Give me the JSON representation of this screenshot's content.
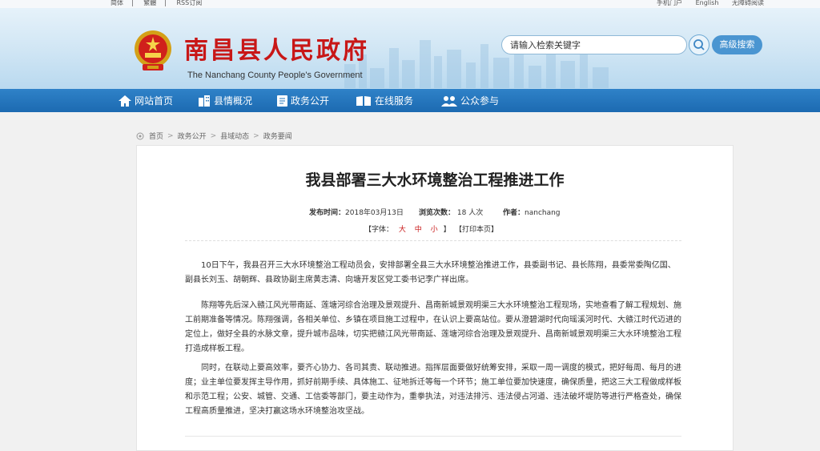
{
  "topbar": {
    "left_items": [
      "简体",
      "繁體",
      "RSS订阅"
    ],
    "right_items": [
      "手机门户",
      "English",
      "无障碍阅读"
    ]
  },
  "header": {
    "site_title": "南昌县人民政府",
    "site_subtitle": "The Nanchang County People's Government",
    "search_placeholder": "请输入检索关键字",
    "advanced_search_label": "高级搜索",
    "emblem_icon": "national-emblem-icon",
    "search_icon": "search-icon",
    "brand_color": "#c81717",
    "nav_color": "#1f6fb6"
  },
  "nav": {
    "items": [
      {
        "label": "网站首页",
        "icon": "home-icon"
      },
      {
        "label": "县情概况",
        "icon": "building-icon"
      },
      {
        "label": "政务公开",
        "icon": "document-icon"
      },
      {
        "label": "在线服务",
        "icon": "book-icon"
      },
      {
        "label": "公众参与",
        "icon": "users-icon"
      }
    ]
  },
  "breadcrumb": [
    "首页",
    "政务公开",
    "县域动态",
    "政务要闻"
  ],
  "article": {
    "title": "我县部署三大水环境整治工程推进工作",
    "publish_label": "发布时间：",
    "publish_date": "2018年03月13日",
    "views_label": "浏览次数：",
    "views_value": "18",
    "views_unit": "人次",
    "author_label": "作者：",
    "author": "nanchang",
    "font_label": "【字体：",
    "font_sizes": [
      "大",
      "中",
      "小"
    ],
    "font_close": "】",
    "print_label": "【打印本页】",
    "paragraphs": [
      "10日下午，我县召开三大水环境整治工程动员会，安排部署全县三大水环境整治推进工作，县委副书记、县长陈翔，县委常委陶亿国、副县长刘玉、胡朝辉、县政协副主席黄志清、向塘开发区党工委书记李广祥出席。",
      "陈翔等先后深入赣江风光带南延、莲塘河综合治理及景观提升、昌南新城景观明渠三大水环境整治工程现场，实地查看了解工程规划、施工前期准备等情况。陈翔强调，各相关单位、乡镇在项目施工过程中，在认识上要高站位。要从澄碧湖时代向瑶溪河时代、大赣江时代迈进的定位上，做好全县的水脉文章，提升城市品味，切实把赣江风光带南延、莲塘河综合治理及景观提升、昌南新城景观明渠三大水环境整治工程打造成样板工程。",
      "同时，在联动上要高效率，要齐心协力、各司其责、联动推进。指挥层面要做好统筹安排，采取一周一调度的模式，把好每周、每月的进度；业主单位要发挥主导作用，抓好前期手续、具体施工、征地拆迁等每一个环节；施工单位要加快速度，确保质量，把这三大工程做成样板和示范工程；公安、城管、交通、工信委等部门，要主动作为，重拳执法，对违法排污、违法侵占河道、违法破坏堤防等进行严格查处，确保工程高质量推进，坚决打赢这场水环境整治攻坚战。"
    ]
  }
}
